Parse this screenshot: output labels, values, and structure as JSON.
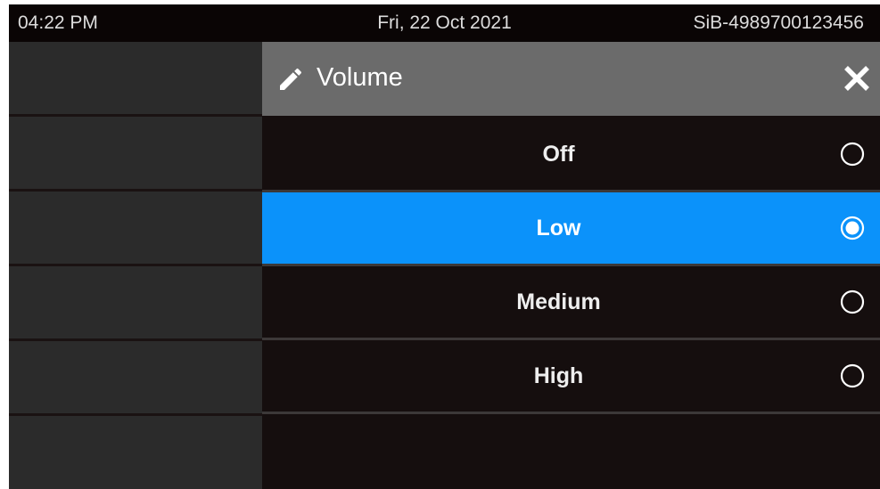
{
  "status_bar": {
    "time": "04:22 PM",
    "date": "Fri, 22 Oct 2021",
    "device_id": "SiB-4989700123456"
  },
  "dialog": {
    "title": "Volume",
    "title_icon": "pencil-icon",
    "close_icon": "close-icon",
    "options": [
      {
        "label": "Off",
        "selected": false
      },
      {
        "label": "Low",
        "selected": true
      },
      {
        "label": "Medium",
        "selected": false
      },
      {
        "label": "High",
        "selected": false
      }
    ]
  },
  "colors": {
    "background": "#150e0e",
    "status_bar": "#0a0505",
    "header": "#6b6b6b",
    "accent_selected": "#0b92fa",
    "left_slot": "#2b2b2b",
    "text": "#eeeeee"
  }
}
